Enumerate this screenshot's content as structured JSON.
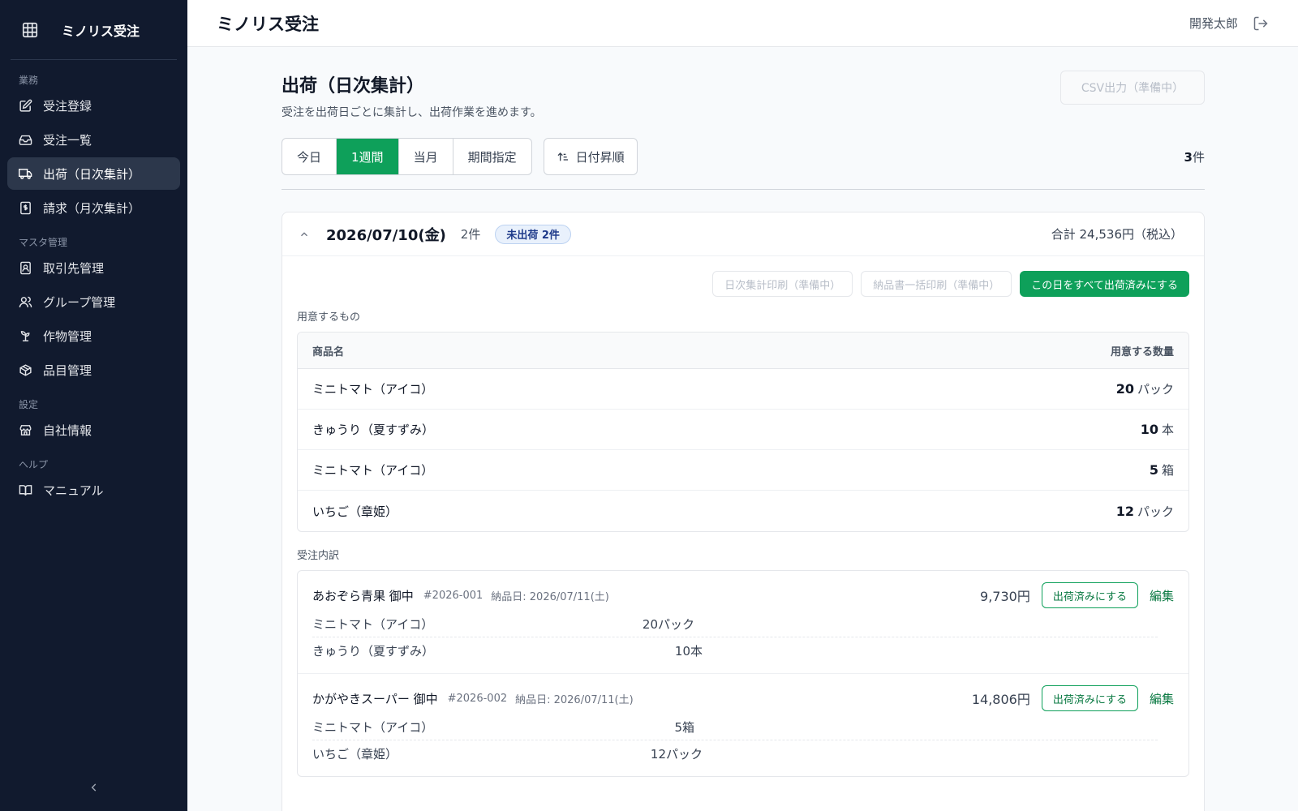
{
  "app": {
    "name": "ミノリス受注"
  },
  "sidebar": {
    "sections": [
      {
        "label": "業務",
        "items": [
          {
            "label": "受注登録",
            "icon": "edit-icon"
          },
          {
            "label": "受注一覧",
            "icon": "inbox-icon"
          },
          {
            "label": "出荷（日次集計）",
            "icon": "truck-icon",
            "active": true
          },
          {
            "label": "請求（月次集計）",
            "icon": "invoice-icon"
          }
        ]
      },
      {
        "label": "マスタ管理",
        "items": [
          {
            "label": "取引先管理",
            "icon": "contact-icon"
          },
          {
            "label": "グループ管理",
            "icon": "users-icon"
          },
          {
            "label": "作物管理",
            "icon": "sprout-icon"
          },
          {
            "label": "品目管理",
            "icon": "package-icon"
          }
        ]
      },
      {
        "label": "設定",
        "items": [
          {
            "label": "自社情報",
            "icon": "store-icon"
          }
        ]
      },
      {
        "label": "ヘルプ",
        "items": [
          {
            "label": "マニュアル",
            "icon": "book-icon"
          }
        ]
      }
    ]
  },
  "topbar": {
    "title": "ミノリス受注",
    "user": "開発太郎"
  },
  "page": {
    "title": "出荷（日次集計）",
    "description": "受注を出荷日ごとに集計し、出荷作業を進めます。",
    "csv_button": "CSV出力（準備中）"
  },
  "filters": {
    "periods": [
      "今日",
      "1週間",
      "当月",
      "期間指定"
    ],
    "selected": "1週間",
    "sort_label": "日付昇順",
    "count_value": "3",
    "count_unit": "件"
  },
  "day": {
    "date": "2026/07/10(金)",
    "count": "2件",
    "badge": "未出荷 2件",
    "total": "合計 24,536円（税込）",
    "actions": {
      "daily_print": "日次集計印刷（準備中）",
      "bulk_print": "納品書一括印刷（準備中）",
      "mark_all": "この日をすべて出荷済みにする"
    },
    "prep": {
      "label": "用意するもの",
      "col_name": "商品名",
      "col_qty": "用意する数量",
      "rows": [
        {
          "name": "ミニトマト（アイコ）",
          "qty": "20",
          "unit": "パック"
        },
        {
          "name": "きゅうり（夏すずみ）",
          "qty": "10",
          "unit": "本"
        },
        {
          "name": "ミニトマト（アイコ）",
          "qty": "5",
          "unit": "箱"
        },
        {
          "name": "いちご（章姫）",
          "qty": "12",
          "unit": "パック"
        }
      ]
    },
    "orders_label": "受注内訳",
    "orders": [
      {
        "customer": "あおぞら青果 御中",
        "number": "#2026-001",
        "delivery": "納品日: 2026/07/11(土)",
        "price": "9,730円",
        "ship_label": "出荷済みにする",
        "edit_label": "編集",
        "lines": [
          {
            "name": "ミニトマト（アイコ）",
            "qty": "20パック"
          },
          {
            "name": "きゅうり（夏すずみ）",
            "qty": "10本"
          }
        ]
      },
      {
        "customer": "かがやきスーパー 御中",
        "number": "#2026-002",
        "delivery": "納品日: 2026/07/11(土)",
        "price": "14,806円",
        "ship_label": "出荷済みにする",
        "edit_label": "編集",
        "lines": [
          {
            "name": "ミニトマト（アイコ）",
            "qty": "5箱"
          },
          {
            "name": "いちご（章姫）",
            "qty": "12パック"
          }
        ]
      }
    ]
  },
  "colors": {
    "sidebar_bg": "#111a2e",
    "accent_green": "#0ea05a",
    "badge_blue": "#1e3a8a"
  }
}
